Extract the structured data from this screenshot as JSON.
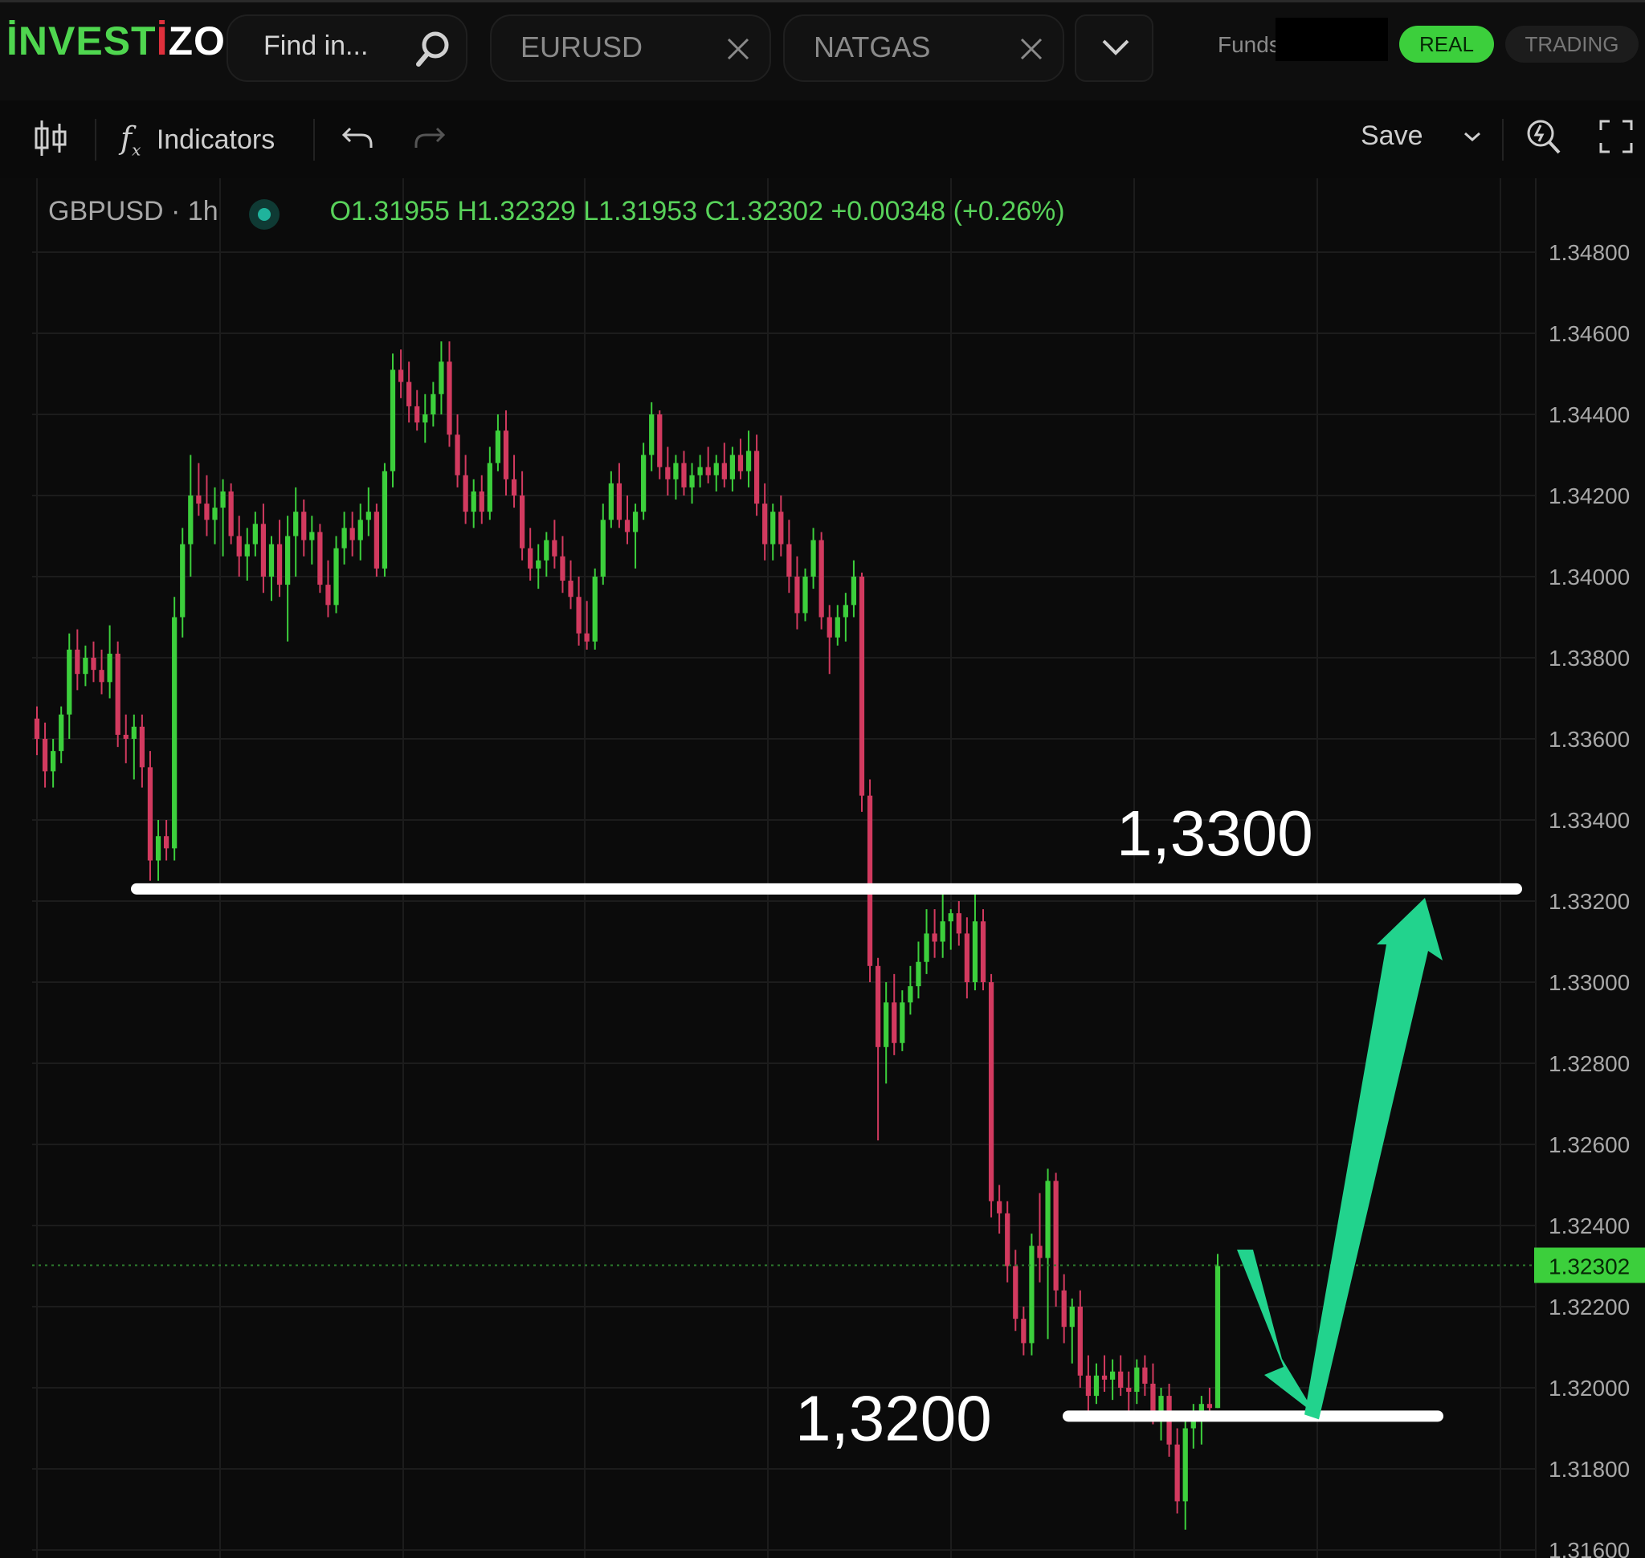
{
  "app": {
    "logo_text_a": "İNVEST",
    "logo_text_b": "İ",
    "logo_text_c": "ZO",
    "search_placeholder": "Find in...",
    "tabs": [
      {
        "label": "EURUSD"
      },
      {
        "label": "NATGAS"
      }
    ],
    "funds_label": "Funds",
    "mode_real": "REAL",
    "mode_trading": "TRADING"
  },
  "toolbar": {
    "indicators_label": "Indicators",
    "save_label": "Save"
  },
  "legend": {
    "symbol": "GBPUSD · 1h",
    "open": "O1.31955",
    "high": "H1.32329",
    "low": "L1.31953",
    "close": "C1.32302",
    "change": "+0.00348 (+0.26%)"
  },
  "colors": {
    "up": "#3ccf3c",
    "down": "#d23a5f",
    "annotation_arrow": "#22d38d",
    "price_tag": "#3ccf3c"
  },
  "chart_data": {
    "type": "candlestick",
    "symbol": "GBPUSD",
    "timeframe": "1h",
    "ylim": [
      1.316,
      1.349
    ],
    "y_ticks": [
      "1.34800",
      "1.34600",
      "1.34400",
      "1.34200",
      "1.34000",
      "1.33800",
      "1.33600",
      "1.33400",
      "1.33200",
      "1.33000",
      "1.32800",
      "1.32600",
      "1.32400",
      "1.32200",
      "1.32000",
      "1.31800",
      "1.31600"
    ],
    "last_price": "1.32302",
    "annotations": [
      {
        "label": "1,3300",
        "price": 1.3323
      },
      {
        "label": "1,3200",
        "price": 1.3193
      }
    ],
    "candles": [
      [
        1.3365,
        1.3368,
        1.3356,
        1.336
      ],
      [
        1.336,
        1.3364,
        1.3348,
        1.3352
      ],
      [
        1.3352,
        1.336,
        1.3348,
        1.3357
      ],
      [
        1.3357,
        1.3368,
        1.3354,
        1.3366
      ],
      [
        1.3366,
        1.3386,
        1.336,
        1.3382
      ],
      [
        1.3382,
        1.3387,
        1.3372,
        1.3376
      ],
      [
        1.3376,
        1.3383,
        1.3373,
        1.338
      ],
      [
        1.338,
        1.3384,
        1.3374,
        1.3377
      ],
      [
        1.3377,
        1.3382,
        1.3371,
        1.3374
      ],
      [
        1.3374,
        1.3388,
        1.337,
        1.3381
      ],
      [
        1.3381,
        1.3384,
        1.3358,
        1.3361
      ],
      [
        1.3361,
        1.3366,
        1.3354,
        1.336
      ],
      [
        1.336,
        1.3366,
        1.335,
        1.3363
      ],
      [
        1.3363,
        1.3366,
        1.3348,
        1.3353
      ],
      [
        1.3353,
        1.3357,
        1.3325,
        1.333
      ],
      [
        1.333,
        1.334,
        1.3325,
        1.3336
      ],
      [
        1.3336,
        1.334,
        1.333,
        1.3333
      ],
      [
        1.3333,
        1.3395,
        1.333,
        1.339
      ],
      [
        1.339,
        1.3412,
        1.3385,
        1.3408
      ],
      [
        1.3408,
        1.343,
        1.34,
        1.342
      ],
      [
        1.342,
        1.3428,
        1.3415,
        1.3418
      ],
      [
        1.3418,
        1.3425,
        1.341,
        1.3414
      ],
      [
        1.3414,
        1.3422,
        1.3408,
        1.3417
      ],
      [
        1.3417,
        1.3424,
        1.3405,
        1.3421
      ],
      [
        1.3421,
        1.3423,
        1.3408,
        1.341
      ],
      [
        1.341,
        1.3415,
        1.34,
        1.3405
      ],
      [
        1.3405,
        1.3412,
        1.3399,
        1.3408
      ],
      [
        1.3408,
        1.3416,
        1.3405,
        1.3413
      ],
      [
        1.3413,
        1.3418,
        1.3396,
        1.34
      ],
      [
        1.34,
        1.341,
        1.3394,
        1.3408
      ],
      [
        1.3408,
        1.3414,
        1.3395,
        1.3398
      ],
      [
        1.3398,
        1.3415,
        1.3384,
        1.341
      ],
      [
        1.341,
        1.3422,
        1.34,
        1.3416
      ],
      [
        1.3416,
        1.3419,
        1.3405,
        1.3409
      ],
      [
        1.3409,
        1.3415,
        1.3403,
        1.3411
      ],
      [
        1.3411,
        1.3413,
        1.3396,
        1.3398
      ],
      [
        1.3398,
        1.3404,
        1.339,
        1.3393
      ],
      [
        1.3393,
        1.341,
        1.3391,
        1.3407
      ],
      [
        1.3407,
        1.3416,
        1.3403,
        1.3412
      ],
      [
        1.3412,
        1.3416,
        1.3405,
        1.3409
      ],
      [
        1.3409,
        1.3418,
        1.3404,
        1.3414
      ],
      [
        1.3414,
        1.3422,
        1.341,
        1.3416
      ],
      [
        1.3416,
        1.3418,
        1.34,
        1.3402
      ],
      [
        1.3402,
        1.3428,
        1.34,
        1.3426
      ],
      [
        1.3426,
        1.3455,
        1.3422,
        1.3451
      ],
      [
        1.3451,
        1.3456,
        1.3444,
        1.3448
      ],
      [
        1.3448,
        1.3453,
        1.3438,
        1.3442
      ],
      [
        1.3442,
        1.3446,
        1.3436,
        1.3438
      ],
      [
        1.3438,
        1.3445,
        1.3433,
        1.344
      ],
      [
        1.344,
        1.3448,
        1.3437,
        1.3445
      ],
      [
        1.3445,
        1.3458,
        1.344,
        1.3453
      ],
      [
        1.3453,
        1.3458,
        1.3432,
        1.3435
      ],
      [
        1.3435,
        1.344,
        1.3422,
        1.3425
      ],
      [
        1.3425,
        1.343,
        1.3413,
        1.3416
      ],
      [
        1.3416,
        1.3424,
        1.3412,
        1.3421
      ],
      [
        1.3421,
        1.3425,
        1.3413,
        1.3416
      ],
      [
        1.3416,
        1.3432,
        1.3414,
        1.3428
      ],
      [
        1.3428,
        1.344,
        1.3426,
        1.3436
      ],
      [
        1.3436,
        1.3441,
        1.342,
        1.3424
      ],
      [
        1.3424,
        1.343,
        1.3417,
        1.342
      ],
      [
        1.342,
        1.3426,
        1.3404,
        1.3407
      ],
      [
        1.3407,
        1.3412,
        1.3399,
        1.3402
      ],
      [
        1.3402,
        1.3408,
        1.3397,
        1.3404
      ],
      [
        1.3404,
        1.3411,
        1.34,
        1.3409
      ],
      [
        1.3409,
        1.3414,
        1.3402,
        1.3405
      ],
      [
        1.3405,
        1.341,
        1.3396,
        1.3399
      ],
      [
        1.3399,
        1.3404,
        1.3392,
        1.3395
      ],
      [
        1.3395,
        1.34,
        1.3383,
        1.3386
      ],
      [
        1.3386,
        1.3394,
        1.3382,
        1.3384
      ],
      [
        1.3384,
        1.3402,
        1.3382,
        1.34
      ],
      [
        1.34,
        1.3418,
        1.3398,
        1.3414
      ],
      [
        1.3414,
        1.3426,
        1.3412,
        1.3423
      ],
      [
        1.3423,
        1.3428,
        1.3412,
        1.3414
      ],
      [
        1.3414,
        1.342,
        1.3408,
        1.3411
      ],
      [
        1.3411,
        1.3418,
        1.3402,
        1.3416
      ],
      [
        1.3416,
        1.3433,
        1.3414,
        1.343
      ],
      [
        1.343,
        1.3443,
        1.3426,
        1.344
      ],
      [
        1.344,
        1.3441,
        1.3424,
        1.3427
      ],
      [
        1.3427,
        1.3432,
        1.342,
        1.3424
      ],
      [
        1.3424,
        1.343,
        1.3419,
        1.3428
      ],
      [
        1.3428,
        1.3431,
        1.342,
        1.3422
      ],
      [
        1.3422,
        1.3428,
        1.3418,
        1.3425
      ],
      [
        1.3425,
        1.343,
        1.3422,
        1.3427
      ],
      [
        1.3427,
        1.3432,
        1.3423,
        1.3425
      ],
      [
        1.3425,
        1.343,
        1.3421,
        1.3428
      ],
      [
        1.3428,
        1.3433,
        1.3422,
        1.3424
      ],
      [
        1.3424,
        1.3432,
        1.3421,
        1.343
      ],
      [
        1.343,
        1.3434,
        1.3424,
        1.3426
      ],
      [
        1.3426,
        1.3436,
        1.3422,
        1.3431
      ],
      [
        1.3431,
        1.3435,
        1.3415,
        1.3418
      ],
      [
        1.3418,
        1.3423,
        1.3404,
        1.3408
      ],
      [
        1.3408,
        1.3418,
        1.3404,
        1.3416
      ],
      [
        1.3416,
        1.342,
        1.3405,
        1.3408
      ],
      [
        1.3408,
        1.3414,
        1.3396,
        1.34
      ],
      [
        1.34,
        1.3405,
        1.3387,
        1.3391
      ],
      [
        1.3391,
        1.3402,
        1.3389,
        1.34
      ],
      [
        1.34,
        1.3412,
        1.3397,
        1.3409
      ],
      [
        1.3409,
        1.3411,
        1.3387,
        1.339
      ],
      [
        1.339,
        1.3393,
        1.3376,
        1.3385
      ],
      [
        1.3385,
        1.3393,
        1.3383,
        1.339
      ],
      [
        1.339,
        1.3396,
        1.3384,
        1.3393
      ],
      [
        1.3393,
        1.3404,
        1.339,
        1.34
      ],
      [
        1.34,
        1.3401,
        1.3342,
        1.3346
      ],
      [
        1.3346,
        1.335,
        1.33,
        1.3304
      ],
      [
        1.3304,
        1.3306,
        1.3261,
        1.3284
      ],
      [
        1.3284,
        1.33,
        1.3275,
        1.3295
      ],
      [
        1.3295,
        1.3302,
        1.3282,
        1.3285
      ],
      [
        1.3285,
        1.3298,
        1.3283,
        1.3295
      ],
      [
        1.3295,
        1.3304,
        1.3292,
        1.3299
      ],
      [
        1.3299,
        1.331,
        1.3296,
        1.3305
      ],
      [
        1.3305,
        1.3318,
        1.3302,
        1.3312
      ],
      [
        1.3312,
        1.3318,
        1.3306,
        1.331
      ],
      [
        1.331,
        1.3322,
        1.3306,
        1.3315
      ],
      [
        1.3315,
        1.3318,
        1.3308,
        1.3317
      ],
      [
        1.3317,
        1.332,
        1.3309,
        1.3312
      ],
      [
        1.3312,
        1.3316,
        1.3296,
        1.33
      ],
      [
        1.33,
        1.3322,
        1.3298,
        1.3315
      ],
      [
        1.3315,
        1.3318,
        1.3298,
        1.33
      ],
      [
        1.33,
        1.3302,
        1.3242,
        1.3246
      ],
      [
        1.3246,
        1.325,
        1.3238,
        1.3243
      ],
      [
        1.3243,
        1.3246,
        1.3226,
        1.323
      ],
      [
        1.323,
        1.3234,
        1.3214,
        1.3217
      ],
      [
        1.3217,
        1.322,
        1.3208,
        1.3211
      ],
      [
        1.3211,
        1.3238,
        1.3208,
        1.3235
      ],
      [
        1.3235,
        1.3248,
        1.3226,
        1.3232
      ],
      [
        1.3232,
        1.3254,
        1.3212,
        1.3251
      ],
      [
        1.3251,
        1.3253,
        1.322,
        1.3224
      ],
      [
        1.3224,
        1.3228,
        1.3211,
        1.3215
      ],
      [
        1.3215,
        1.3222,
        1.3206,
        1.322
      ],
      [
        1.322,
        1.3224,
        1.32,
        1.3203
      ],
      [
        1.3203,
        1.3208,
        1.3193,
        1.3198
      ],
      [
        1.3198,
        1.3206,
        1.3196,
        1.3203
      ],
      [
        1.3203,
        1.3208,
        1.3199,
        1.3202
      ],
      [
        1.3202,
        1.3207,
        1.3197,
        1.3204
      ],
      [
        1.3204,
        1.3208,
        1.3198,
        1.32
      ],
      [
        1.32,
        1.3204,
        1.3193,
        1.3199
      ],
      [
        1.3199,
        1.3207,
        1.3196,
        1.3205
      ],
      [
        1.3205,
        1.3208,
        1.3198,
        1.3201
      ],
      [
        1.3201,
        1.3206,
        1.3191,
        1.3194
      ],
      [
        1.3194,
        1.32,
        1.3187,
        1.3198
      ],
      [
        1.3198,
        1.3201,
        1.3183,
        1.3186
      ],
      [
        1.3186,
        1.319,
        1.3169,
        1.3172
      ],
      [
        1.3172,
        1.3194,
        1.3165,
        1.319
      ],
      [
        1.319,
        1.3196,
        1.3185,
        1.3193
      ],
      [
        1.3193,
        1.3198,
        1.3186,
        1.3196
      ],
      [
        1.3196,
        1.32,
        1.3192,
        1.3195
      ],
      [
        1.3195,
        1.3233,
        1.3195,
        1.323
      ]
    ]
  }
}
